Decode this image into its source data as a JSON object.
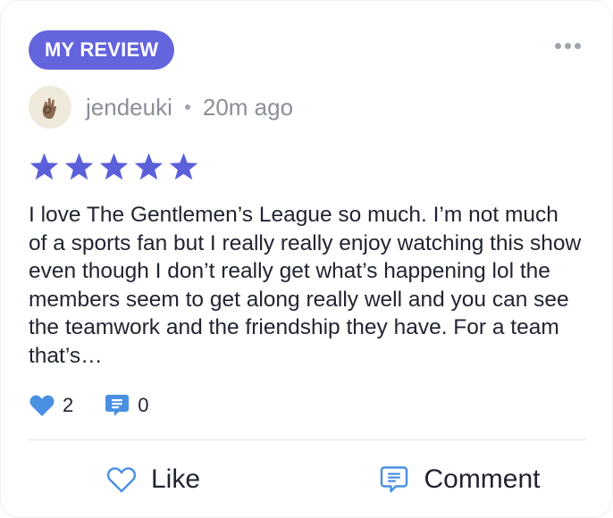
{
  "badge": {
    "label": "MY REVIEW"
  },
  "colors": {
    "accent": "#6464dc",
    "star": "#5b5fd9",
    "like_icon": "#4a90e2",
    "comment_icon": "#4a90e2",
    "muted_text": "#8a8f99"
  },
  "author": {
    "avatar_icon": "ok-hand-avatar",
    "username": "jendeuki",
    "time": "20m ago"
  },
  "rating": {
    "stars": 5,
    "max": 5,
    "icon": "star-icon"
  },
  "review": {
    "text": "I love The Gentlemen’s League so much. I’m not much of a sports fan but I really really enjoy watching this show even though I don’t really get what’s happening lol the members seem to get along really well and you can see the teamwork and the friendship they have. For a team that’s…"
  },
  "stats": {
    "likes": "2",
    "comments": "0"
  },
  "actions": {
    "like_label": "Like",
    "comment_label": "Comment"
  }
}
